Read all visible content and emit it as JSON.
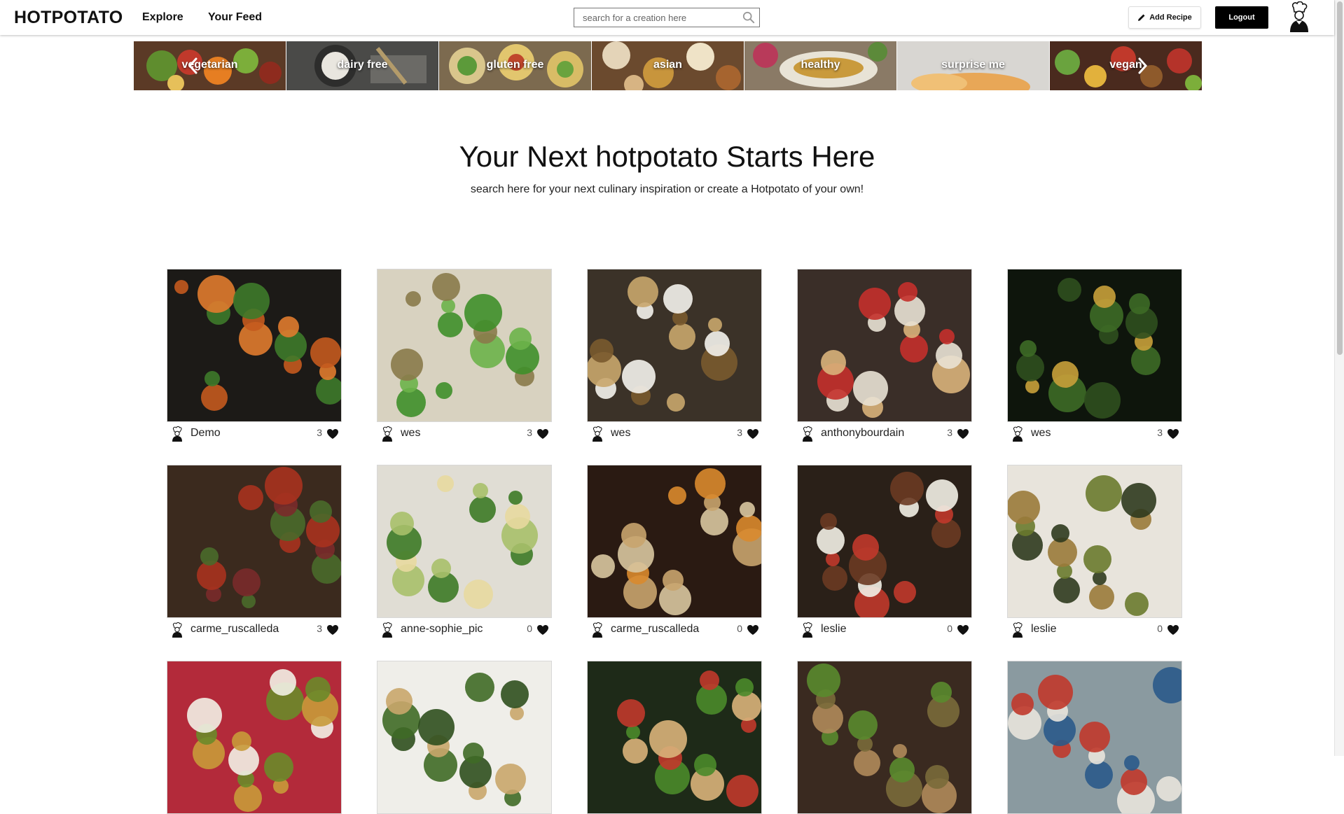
{
  "header": {
    "logo": "HOTPOTATO",
    "nav": [
      "Explore",
      "Your Feed"
    ],
    "search_placeholder": "search for a creation here",
    "add_recipe_label": "Add Recipe",
    "logout_label": "Logout"
  },
  "categories": [
    "vegetarian",
    "dairy free",
    "gluten free",
    "asian",
    "healthy",
    "surprise me",
    "vegan"
  ],
  "hero": {
    "title": "Your Next hotpotato Starts Here",
    "subtitle": "search here for your next culinary inspiration or create a Hotpotato of your own!"
  },
  "recipes": [
    {
      "user": "Demo",
      "likes": "3"
    },
    {
      "user": "wes",
      "likes": "3"
    },
    {
      "user": "wes",
      "likes": "3"
    },
    {
      "user": "anthonybourdain",
      "likes": "3"
    },
    {
      "user": "wes",
      "likes": "3"
    },
    {
      "user": "carme_ruscalleda",
      "likes": "3"
    },
    {
      "user": "anne-sophie_pic",
      "likes": "0"
    },
    {
      "user": "carme_ruscalleda",
      "likes": "0"
    },
    {
      "user": "leslie",
      "likes": "0"
    },
    {
      "user": "leslie",
      "likes": "0"
    },
    {
      "user": "",
      "likes": ""
    },
    {
      "user": "",
      "likes": ""
    },
    {
      "user": "",
      "likes": ""
    },
    {
      "user": "",
      "likes": ""
    },
    {
      "user": "",
      "likes": ""
    }
  ],
  "colors": {
    "logout_bg": "#000000",
    "heart": "#111111"
  }
}
